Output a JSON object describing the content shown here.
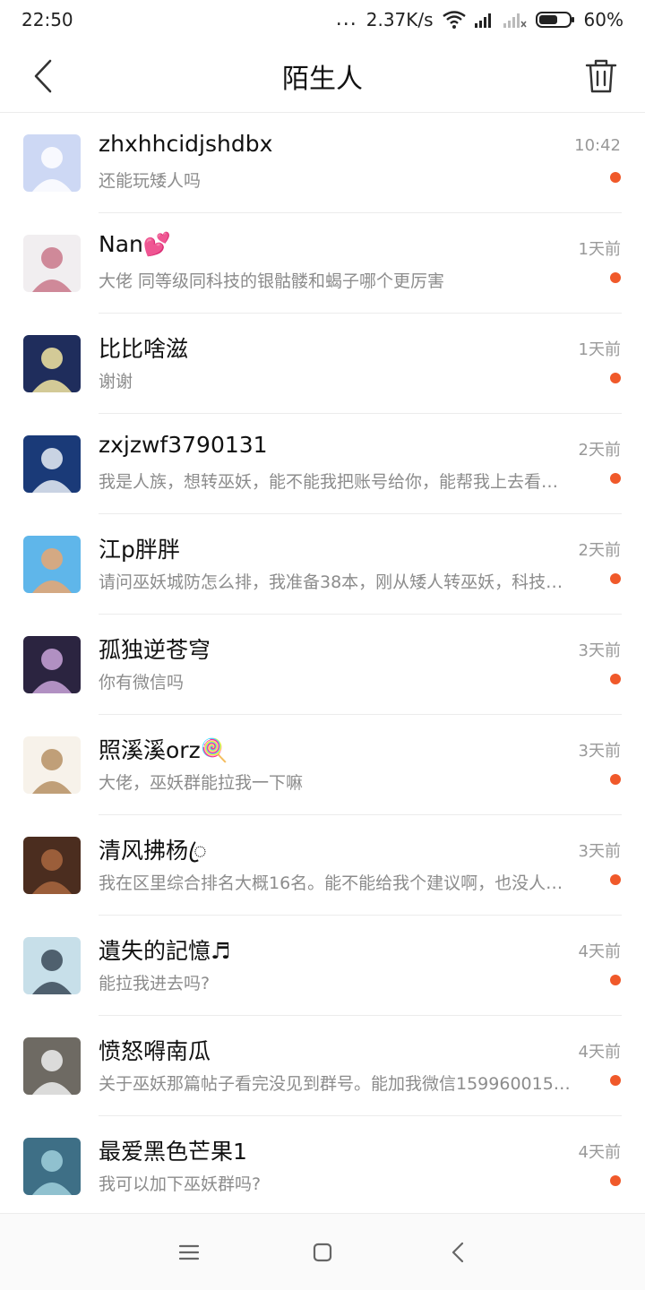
{
  "status_bar": {
    "time": "22:50",
    "dots": "...",
    "net_speed": "2.37K/s",
    "battery": "60%"
  },
  "header": {
    "title": "陌生人"
  },
  "conversations": [
    {
      "name": "zhxhhcidjshdbx",
      "preview": "还能玩矮人吗",
      "time": "10:42",
      "avatar_colors": [
        "#cdd8f4",
        "#ffffff"
      ]
    },
    {
      "name": "Nan💕",
      "preview": "大佬 同等级同科技的银骷髅和蝎子哪个更厉害",
      "time": "1天前",
      "avatar_colors": [
        "#f1eef0",
        "#c9778a"
      ]
    },
    {
      "name": "比比啥滋",
      "preview": "谢谢",
      "time": "1天前",
      "avatar_colors": [
        "#1f2d5c",
        "#f3e6a1"
      ]
    },
    {
      "name": "zxjzwf3790131",
      "preview": "我是人族，想转巫妖，能不能我把账号给你，能帮我上去看…",
      "time": "2天前",
      "avatar_colors": [
        "#1a3a78",
        "#e9eef6"
      ]
    },
    {
      "name": "江p胖胖",
      "preview": "请问巫妖城防怎么排，我准备38本，刚从矮人转巫妖，科技…",
      "time": "2天前",
      "avatar_colors": [
        "#5fb6ea",
        "#e9a771"
      ]
    },
    {
      "name": "孤独逆苍穹",
      "preview": "你有微信吗",
      "time": "3天前",
      "avatar_colors": [
        "#2b2440",
        "#c9a3d9"
      ]
    },
    {
      "name": "照溪溪orz🍭",
      "preview": "大佬，巫妖群能拉我一下嘛",
      "time": "3天前",
      "avatar_colors": [
        "#f7f2ea",
        "#b69164"
      ]
    },
    {
      "name": "清风拂杨ꦿ",
      "preview": "我在区里综合排名大概16名。能不能给我个建议啊，也没人…",
      "time": "3天前",
      "avatar_colors": [
        "#4b2d1f",
        "#a9673f"
      ]
    },
    {
      "name": "遺失的記憶♬",
      "preview": "能拉我进去吗?",
      "time": "4天前",
      "avatar_colors": [
        "#c7dfe9",
        "#3a4a58"
      ]
    },
    {
      "name": "愤怒嘚南瓜",
      "preview": "关于巫妖那篇帖子看完没见到群号。能加我微信159960015…",
      "time": "4天前",
      "avatar_colors": [
        "#6e6a63",
        "#eeeeee"
      ]
    },
    {
      "name": "最爱黑色芒果1",
      "preview": "我可以加下巫妖群吗?",
      "time": "4天前",
      "avatar_colors": [
        "#3e6f86",
        "#9fd0dc"
      ]
    }
  ],
  "colors": {
    "accent_dot": "#f0592a",
    "secondary_text": "#8c8c8c"
  }
}
